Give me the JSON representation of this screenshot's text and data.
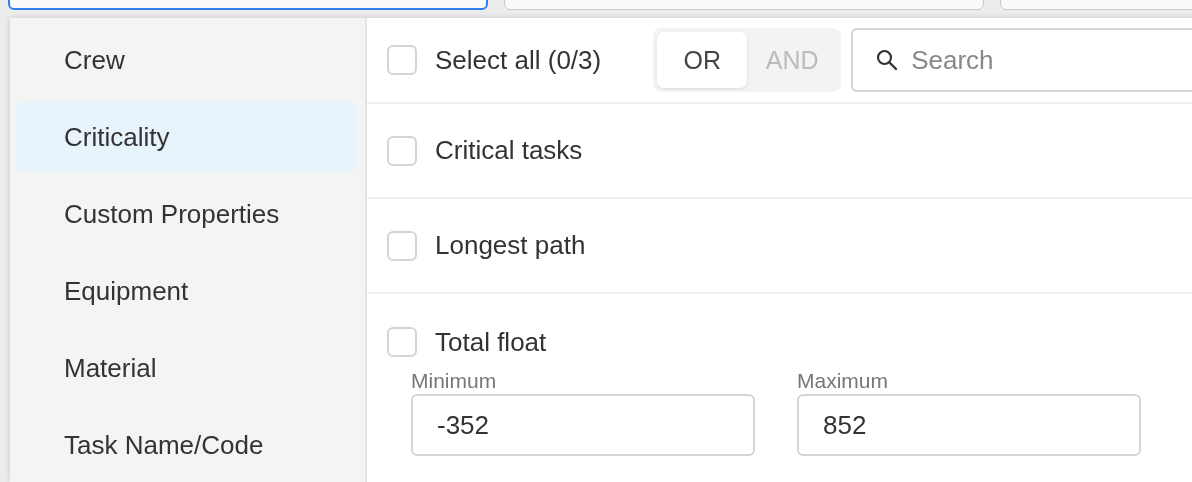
{
  "top_fields": [
    {
      "focused": true
    },
    {
      "focused": false
    },
    {
      "focused": false
    }
  ],
  "categories": [
    {
      "label": "Crew",
      "selected": false
    },
    {
      "label": "Criticality",
      "selected": true
    },
    {
      "label": "Custom Properties",
      "selected": false
    },
    {
      "label": "Equipment",
      "selected": false
    },
    {
      "label": "Material",
      "selected": false
    },
    {
      "label": "Task Name/Code",
      "selected": false
    }
  ],
  "select_all": {
    "label": "Select all (0/3)",
    "checked": false
  },
  "logic_toggle": [
    {
      "label": "OR",
      "selected": true
    },
    {
      "label": "AND",
      "selected": false
    }
  ],
  "search": {
    "placeholder": "Search"
  },
  "options": [
    {
      "label": "Critical tasks",
      "checked": false
    },
    {
      "label": "Longest path",
      "checked": false
    },
    {
      "label": "Total float",
      "checked": false,
      "range": {
        "min_label": "Minimum",
        "min_value": "-352",
        "max_label": "Maximum",
        "max_value": "852"
      }
    }
  ]
}
